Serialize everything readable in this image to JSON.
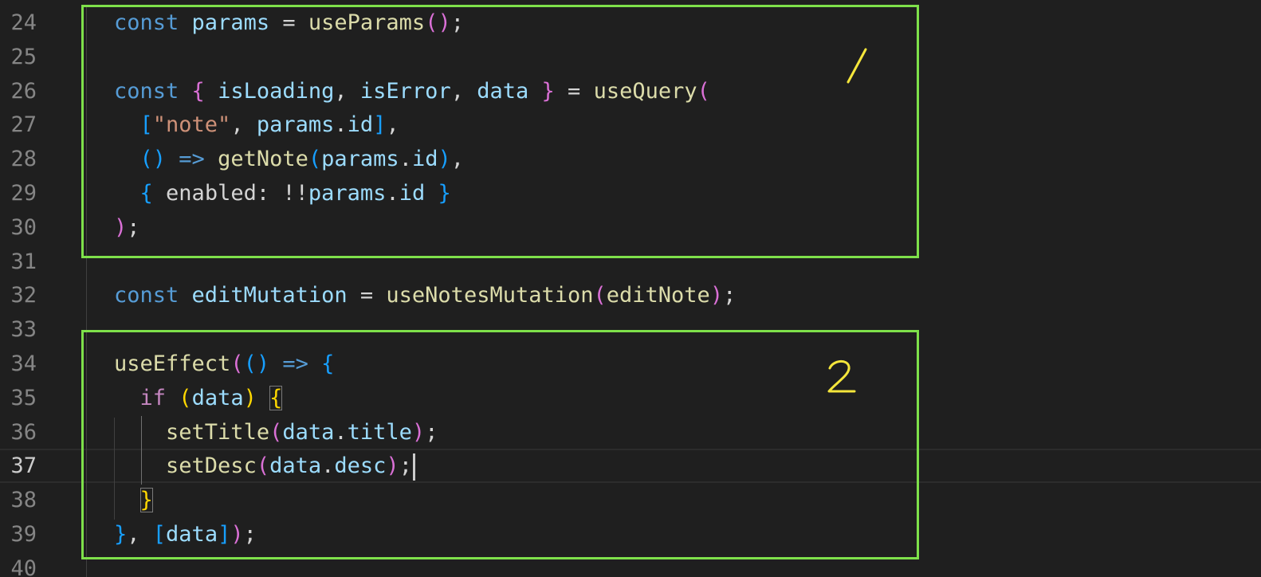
{
  "editor": {
    "current_line": 37,
    "lines": [
      {
        "n": "24",
        "tokens": [
          {
            "t": "const",
            "c": "kw"
          },
          {
            "t": " ",
            "c": "plain"
          },
          {
            "t": "params",
            "c": "var"
          },
          {
            "t": " = ",
            "c": "plain"
          },
          {
            "t": "useParams",
            "c": "fn"
          },
          {
            "t": "()",
            "c": "p1"
          },
          {
            "t": ";",
            "c": "plain"
          }
        ]
      },
      {
        "n": "25",
        "tokens": []
      },
      {
        "n": "26",
        "tokens": [
          {
            "t": "const",
            "c": "kw"
          },
          {
            "t": " ",
            "c": "plain"
          },
          {
            "t": "{",
            "c": "p1"
          },
          {
            "t": " ",
            "c": "plain"
          },
          {
            "t": "isLoading",
            "c": "var"
          },
          {
            "t": ", ",
            "c": "plain"
          },
          {
            "t": "isError",
            "c": "var"
          },
          {
            "t": ", ",
            "c": "plain"
          },
          {
            "t": "data",
            "c": "var"
          },
          {
            "t": " ",
            "c": "plain"
          },
          {
            "t": "}",
            "c": "p1"
          },
          {
            "t": " = ",
            "c": "plain"
          },
          {
            "t": "useQuery",
            "c": "fn"
          },
          {
            "t": "(",
            "c": "p1"
          }
        ]
      },
      {
        "n": "27",
        "tokens": [
          {
            "t": "  ",
            "c": "plain"
          },
          {
            "t": "[",
            "c": "p2"
          },
          {
            "t": "\"note\"",
            "c": "str"
          },
          {
            "t": ", ",
            "c": "plain"
          },
          {
            "t": "params",
            "c": "var"
          },
          {
            "t": ".",
            "c": "plain"
          },
          {
            "t": "id",
            "c": "var"
          },
          {
            "t": "]",
            "c": "p2"
          },
          {
            "t": ",",
            "c": "plain"
          }
        ]
      },
      {
        "n": "28",
        "tokens": [
          {
            "t": "  ",
            "c": "plain"
          },
          {
            "t": "()",
            "c": "p2"
          },
          {
            "t": " ",
            "c": "plain"
          },
          {
            "t": "=>",
            "c": "kw"
          },
          {
            "t": " ",
            "c": "plain"
          },
          {
            "t": "getNote",
            "c": "fn"
          },
          {
            "t": "(",
            "c": "p2"
          },
          {
            "t": "params",
            "c": "var"
          },
          {
            "t": ".",
            "c": "plain"
          },
          {
            "t": "id",
            "c": "var"
          },
          {
            "t": ")",
            "c": "p2"
          },
          {
            "t": ",",
            "c": "plain"
          }
        ]
      },
      {
        "n": "29",
        "tokens": [
          {
            "t": "  ",
            "c": "plain"
          },
          {
            "t": "{",
            "c": "p2"
          },
          {
            "t": " ",
            "c": "plain"
          },
          {
            "t": "enabled",
            "c": "plain"
          },
          {
            "t": ": !!",
            "c": "plain"
          },
          {
            "t": "params",
            "c": "var"
          },
          {
            "t": ".",
            "c": "plain"
          },
          {
            "t": "id",
            "c": "var"
          },
          {
            "t": " ",
            "c": "plain"
          },
          {
            "t": "}",
            "c": "p2"
          }
        ]
      },
      {
        "n": "30",
        "tokens": [
          {
            "t": ")",
            "c": "p1"
          },
          {
            "t": ";",
            "c": "plain"
          }
        ]
      },
      {
        "n": "31",
        "tokens": []
      },
      {
        "n": "32",
        "tokens": [
          {
            "t": "const",
            "c": "kw"
          },
          {
            "t": " ",
            "c": "plain"
          },
          {
            "t": "editMutation",
            "c": "var"
          },
          {
            "t": " = ",
            "c": "plain"
          },
          {
            "t": "useNotesMutation",
            "c": "fn"
          },
          {
            "t": "(",
            "c": "p1"
          },
          {
            "t": "editNote",
            "c": "fn"
          },
          {
            "t": ")",
            "c": "p1"
          },
          {
            "t": ";",
            "c": "plain"
          }
        ]
      },
      {
        "n": "33",
        "tokens": []
      },
      {
        "n": "34",
        "tokens": [
          {
            "t": "useEffect",
            "c": "fn"
          },
          {
            "t": "(",
            "c": "p1"
          },
          {
            "t": "()",
            "c": "p2"
          },
          {
            "t": " ",
            "c": "plain"
          },
          {
            "t": "=>",
            "c": "kw"
          },
          {
            "t": " ",
            "c": "plain"
          },
          {
            "t": "{",
            "c": "p2"
          }
        ]
      },
      {
        "n": "35",
        "tokens": [
          {
            "t": "  ",
            "c": "plain"
          },
          {
            "t": "if",
            "c": "ctl"
          },
          {
            "t": " ",
            "c": "plain"
          },
          {
            "t": "(",
            "c": "p3"
          },
          {
            "t": "data",
            "c": "var"
          },
          {
            "t": ")",
            "c": "p3"
          },
          {
            "t": " ",
            "c": "plain"
          },
          {
            "t": "{",
            "c": "p3 bmatch"
          }
        ]
      },
      {
        "n": "36",
        "tokens": [
          {
            "t": "    ",
            "c": "plain"
          },
          {
            "t": "setTitle",
            "c": "fn"
          },
          {
            "t": "(",
            "c": "p1"
          },
          {
            "t": "data",
            "c": "var"
          },
          {
            "t": ".",
            "c": "plain"
          },
          {
            "t": "title",
            "c": "var"
          },
          {
            "t": ")",
            "c": "p1"
          },
          {
            "t": ";",
            "c": "plain"
          }
        ]
      },
      {
        "n": "37",
        "tokens": [
          {
            "t": "    ",
            "c": "plain"
          },
          {
            "t": "setDesc",
            "c": "fn"
          },
          {
            "t": "(",
            "c": "p1"
          },
          {
            "t": "data",
            "c": "var"
          },
          {
            "t": ".",
            "c": "plain"
          },
          {
            "t": "desc",
            "c": "var"
          },
          {
            "t": ")",
            "c": "p1"
          },
          {
            "t": ";",
            "c": "plain"
          }
        ]
      },
      {
        "n": "38",
        "tokens": [
          {
            "t": "  ",
            "c": "plain"
          },
          {
            "t": "}",
            "c": "p3 bmatch"
          }
        ]
      },
      {
        "n": "39",
        "tokens": [
          {
            "t": "}",
            "c": "p2"
          },
          {
            "t": ", ",
            "c": "plain"
          },
          {
            "t": "[",
            "c": "p2"
          },
          {
            "t": "data",
            "c": "var"
          },
          {
            "t": "]",
            "c": "p2"
          },
          {
            "t": ")",
            "c": "p1"
          },
          {
            "t": ";",
            "c": "plain"
          }
        ]
      },
      {
        "n": "40",
        "tokens": []
      }
    ]
  },
  "annotations": {
    "box1_label": "1",
    "box2_label": "2",
    "box_color": "#7ee04a",
    "marker_color": "#f5e63b"
  }
}
